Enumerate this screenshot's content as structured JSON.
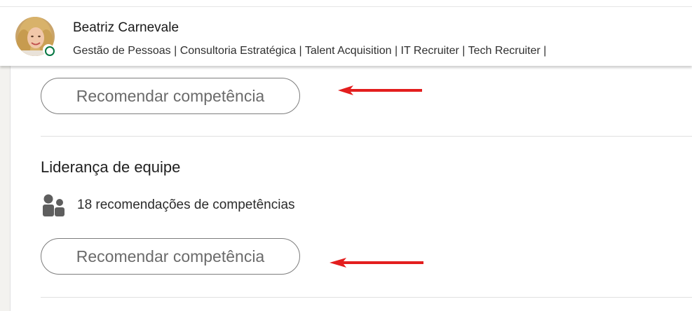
{
  "profile": {
    "name": "Beatriz Carnevale",
    "headline": "Gestão de Pessoas | Consultoria Estratégica | Talent Acquisition | IT Recruiter | Tech Recruiter |",
    "presence_color": "#057642"
  },
  "skills": [
    {
      "button_label": "Recomendar competência"
    },
    {
      "title": "Liderança de equipe",
      "endorsements_text": "18 recomendações de competências",
      "button_label": "Recomendar competência"
    }
  ],
  "annotations": {
    "arrow_color": "#e31e1e"
  }
}
